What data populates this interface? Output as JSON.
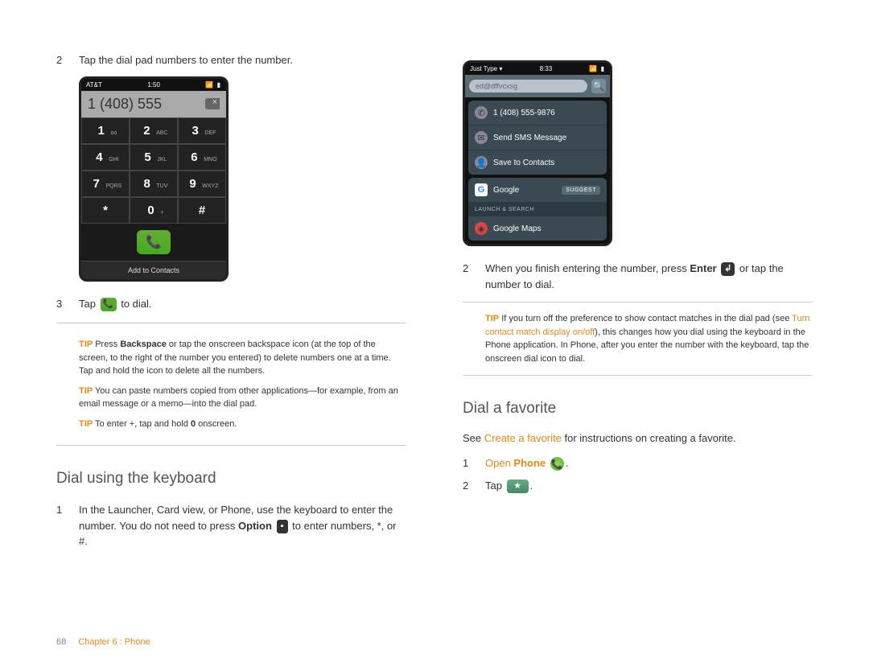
{
  "left": {
    "step2": {
      "num": "2",
      "text": "Tap the dial pad numbers to enter the number."
    },
    "phone1": {
      "status_left": "AT&T",
      "status_time": "1:50",
      "status_right": "📶 ▮",
      "display": "1 (408) 555",
      "keys": [
        {
          "d": "1",
          "l": "ᴏᴏ"
        },
        {
          "d": "2",
          "l": "ABC"
        },
        {
          "d": "3",
          "l": "DEF"
        },
        {
          "d": "4",
          "l": "GHI"
        },
        {
          "d": "5",
          "l": "JKL"
        },
        {
          "d": "6",
          "l": "MNO"
        },
        {
          "d": "7",
          "l": "PQRS"
        },
        {
          "d": "8",
          "l": "TUV"
        },
        {
          "d": "9",
          "l": "WXYZ"
        },
        {
          "d": "*",
          "l": ""
        },
        {
          "d": "0",
          "l": "+"
        },
        {
          "d": "#",
          "l": ""
        }
      ],
      "add_contacts": "Add to Contacts"
    },
    "step3": {
      "num": "3",
      "pre": "Tap ",
      "post": " to dial."
    },
    "tips": [
      {
        "label": "TIP",
        "pre": "Press ",
        "bold": "Backspace",
        "post": " or tap the onscreen backspace icon (at the top of the screen, to the right of the number you entered) to delete numbers one at a time. Tap and hold the icon to delete all the numbers."
      },
      {
        "label": "TIP",
        "text": "You can paste numbers copied from other applications—for example, from an email message or a memo—into the dial pad."
      },
      {
        "label": "TIP",
        "pre": "To enter +, tap and hold ",
        "bold": "0",
        "post": " onscreen."
      }
    ],
    "heading": "Dial using the keyboard",
    "kb_step1": {
      "num": "1",
      "pre": "In the Launcher, Card view, or Phone, use the keyboard to enter the number. You do not need to press ",
      "bold": "Option",
      "post1": " ",
      "post2": " to enter numbers, *, or #."
    }
  },
  "right": {
    "phone2": {
      "status_left": "Just Type ▾",
      "status_time": "8:33",
      "status_right": "📶 ▮",
      "search_value": "ed@dffvcxsg",
      "item_phone": "1 (408) 555-9876",
      "item_sms": "Send SMS Message",
      "item_save": "Save to Contacts",
      "item_google": "Google",
      "suggest": "SUGGEST",
      "launch_header": "LAUNCH & SEARCH",
      "item_maps": "Google Maps"
    },
    "step2": {
      "num": "2",
      "pre": "When you finish entering the number, press ",
      "bold": "Enter",
      "post": " or tap the number to dial."
    },
    "tip": {
      "label": "TIP",
      "pre": "If you turn off the preference to show contact matches in the dial pad (see ",
      "link": "Turn contact match display on/off",
      "post": "), this changes how you dial using the keyboard in the Phone application. In Phone, after you enter the number with the keyboard, tap the onscreen dial icon to dial."
    },
    "heading": "Dial a favorite",
    "see": {
      "pre": "See ",
      "link": "Create a favorite",
      "post": " for instructions on creating a favorite."
    },
    "fav_step1": {
      "num": "1",
      "link_pre": "Open ",
      "link_bold": "Phone",
      "post": " "
    },
    "fav_step2": {
      "num": "2",
      "pre": "Tap ",
      "post": "."
    }
  },
  "footer": {
    "page": "68",
    "chapter": "Chapter 6 : Phone"
  }
}
